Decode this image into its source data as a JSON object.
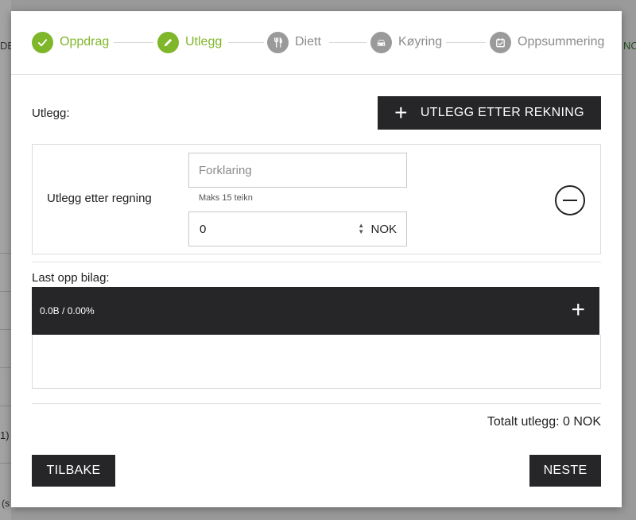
{
  "background": {
    "left_fragment": "DE",
    "right_fragment": "NC",
    "row_fragment": "1)",
    "bottom_fragment": "(s"
  },
  "stepper": {
    "steps": [
      {
        "label": "Oppdrag",
        "icon": "check-icon",
        "state": "done"
      },
      {
        "label": "Utlegg",
        "icon": "pencil-icon",
        "state": "done"
      },
      {
        "label": "Diett",
        "icon": "fork-knife-icon",
        "state": "todo"
      },
      {
        "label": "Køyring",
        "icon": "car-icon",
        "state": "todo"
      },
      {
        "label": "Oppsummering",
        "icon": "calendar-check-icon",
        "state": "todo"
      }
    ],
    "active_color": "#7fb62a",
    "inactive_color": "#9a9a9a"
  },
  "expenses": {
    "section_label": "Utlegg:",
    "add_button_label": "UTLEGG ETTER REKNING",
    "item": {
      "title": "Utlegg etter regning",
      "description_placeholder": "Forklaring",
      "description_value": "",
      "description_hint": "Maks 15 teikn",
      "amount_value": "0",
      "currency": "NOK"
    }
  },
  "upload": {
    "section_label": "Last opp bilag:",
    "status": "0.0B / 0.00%"
  },
  "total": {
    "text": "Totalt utlegg: 0 NOK"
  },
  "footer": {
    "back_label": "TILBAKE",
    "next_label": "NESTE"
  },
  "colors": {
    "dark_button": "#262527",
    "accent_green": "#7fb62a"
  }
}
